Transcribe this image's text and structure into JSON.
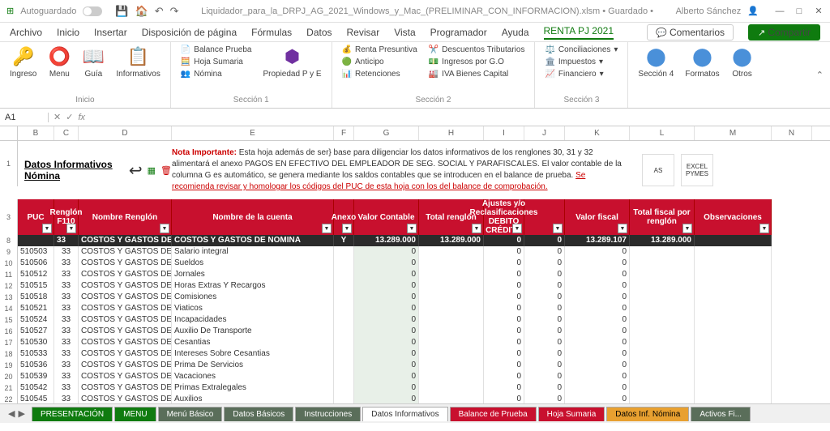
{
  "titlebar": {
    "autosave": "Autoguardado",
    "filename": "Liquidador_para_la_DRPJ_AG_2021_Windows_y_Mac_(PRELIMINAR_CON_INFORMACION).xlsm • Guardado •",
    "user": "Alberto Sánchez"
  },
  "menu": {
    "items": [
      "Archivo",
      "Inicio",
      "Insertar",
      "Disposición de página",
      "Fórmulas",
      "Datos",
      "Revisar",
      "Vista",
      "Programador",
      "Ayuda",
      "RENTA PJ 2021"
    ],
    "comments": "Comentarios",
    "share": "Compartir"
  },
  "ribbon": {
    "g1": {
      "label": "Inicio",
      "items": [
        "Ingreso",
        "Menu",
        "Guía",
        "Informativos"
      ]
    },
    "g2": {
      "label": "Sección 1",
      "big": "Propiedad P y E",
      "small": [
        "Balance Prueba",
        "Hoja Sumaria",
        "Nómina"
      ]
    },
    "g3": {
      "label": "Sección 2",
      "col1": [
        "Renta Presuntiva",
        "Anticipo",
        "Retenciones"
      ],
      "col2": [
        "Descuentos Tributarios",
        "Ingresos por G.O",
        "IVA Bienes Capital"
      ]
    },
    "g4": {
      "label": "Sección 3",
      "items": [
        "Conciliaciones",
        "Impuestos",
        "Financiero"
      ]
    },
    "g5": {
      "items": [
        "Sección 4",
        "Formatos",
        "Otros"
      ]
    }
  },
  "namebox": "A1",
  "cols": [
    "B",
    "C",
    "D",
    "E",
    "F",
    "G",
    "H",
    "I",
    "J",
    "K",
    "L",
    "M",
    "N"
  ],
  "content": {
    "title": "Datos Informativos Nómina",
    "note_bold": "Nota Importante:",
    "note_text": " Esta hoja además de ser} base para diligenciar los datos informativos de los renglones 30, 31 y 32 alimentará el anexo PAGOS EN EFECTIVO DEL EMPLEADOR DE SEG. SOCIAL Y PARAFISCALES. El valor contable de la columna G es automático, se genera mediante los saldos contables que se introducen en el balance de prueba. ",
    "note_red": "Se recomienda revisar y homologar los códigos del PUC de esta hoja con los del balance de comprobación."
  },
  "headers": [
    "PUC",
    "Renglón F110",
    "Nombre Renglón",
    "Nombre de la cuenta",
    "Anexo",
    "Valor Contable",
    "Total renglón",
    "Ajustes y/o Reclasificaciones DEBITO CRÉDITO",
    "",
    "Valor fiscal",
    "Total fiscal por renglón",
    "Observaciones"
  ],
  "totalrow": {
    "renglon": "33",
    "nombre": "COSTOS Y GASTOS DE NO",
    "cuenta": "COSTOS Y GASTOS DE NOMINA",
    "anexo": "Y",
    "valcont": "13.289.000",
    "totren": "13.289.000",
    "aj1": "0",
    "aj2": "0",
    "valfis": "13.289.107",
    "totfis": "13.289.000"
  },
  "rows": [
    {
      "n": "9",
      "puc": "510503",
      "r": "33",
      "nr": "COSTOS Y GASTOS DE NOI",
      "c": "Salario integral"
    },
    {
      "n": "10",
      "puc": "510506",
      "r": "33",
      "nr": "COSTOS Y GASTOS DE NOI",
      "c": "Sueldos"
    },
    {
      "n": "11",
      "puc": "510512",
      "r": "33",
      "nr": "COSTOS Y GASTOS DE NOI",
      "c": "Jornales"
    },
    {
      "n": "12",
      "puc": "510515",
      "r": "33",
      "nr": "COSTOS Y GASTOS DE NOI",
      "c": "Horas Extras Y Recargos"
    },
    {
      "n": "13",
      "puc": "510518",
      "r": "33",
      "nr": "COSTOS Y GASTOS DE NOI",
      "c": "Comisiones"
    },
    {
      "n": "14",
      "puc": "510521",
      "r": "33",
      "nr": "COSTOS Y GASTOS DE NOI",
      "c": "Viaticos"
    },
    {
      "n": "15",
      "puc": "510524",
      "r": "33",
      "nr": "COSTOS Y GASTOS DE NOI",
      "c": "Incapacidades"
    },
    {
      "n": "16",
      "puc": "510527",
      "r": "33",
      "nr": "COSTOS Y GASTOS DE NOI",
      "c": "Auxilio De Transporte"
    },
    {
      "n": "17",
      "puc": "510530",
      "r": "33",
      "nr": "COSTOS Y GASTOS DE NOI",
      "c": "Cesantias"
    },
    {
      "n": "18",
      "puc": "510533",
      "r": "33",
      "nr": "COSTOS Y GASTOS DE NOI",
      "c": "Intereses Sobre Cesantias"
    },
    {
      "n": "19",
      "puc": "510536",
      "r": "33",
      "nr": "COSTOS Y GASTOS DE NOI",
      "c": "Prima De Servicios"
    },
    {
      "n": "20",
      "puc": "510539",
      "r": "33",
      "nr": "COSTOS Y GASTOS DE NOI",
      "c": "Vacaciones"
    },
    {
      "n": "21",
      "puc": "510542",
      "r": "33",
      "nr": "COSTOS Y GASTOS DE NOI",
      "c": "Primas Extralegales"
    },
    {
      "n": "22",
      "puc": "510545",
      "r": "33",
      "nr": "COSTOS Y GASTOS DE NOI",
      "c": "Auxilios"
    }
  ],
  "tabs": [
    {
      "l": "PRESENTACIÓN",
      "bg": "#0f7b0f",
      "fg": "#fff"
    },
    {
      "l": "MENU",
      "bg": "#0f7b0f",
      "fg": "#fff"
    },
    {
      "l": "Menú Básico",
      "bg": "#5a6e5a",
      "fg": "#fff"
    },
    {
      "l": "Datos Básicos",
      "bg": "#5a6e5a",
      "fg": "#fff"
    },
    {
      "l": "Instrucciones",
      "bg": "#5a6e5a",
      "fg": "#fff"
    },
    {
      "l": "Datos Informativos",
      "bg": "#fff",
      "fg": "#333"
    },
    {
      "l": "Balance de Prueba",
      "bg": "#c8102e",
      "fg": "#fff"
    },
    {
      "l": "Hoja Sumaria",
      "bg": "#c8102e",
      "fg": "#fff"
    },
    {
      "l": "Datos Inf. Nómina",
      "bg": "#e8a030",
      "fg": "#000"
    },
    {
      "l": "Activos Fi...",
      "bg": "#5a6e5a",
      "fg": "#fff"
    }
  ],
  "colwidths": {
    "B": 45,
    "C": 30,
    "D": 115,
    "E": 200,
    "F": 25,
    "G": 80,
    "H": 80,
    "I": 50,
    "J": 50,
    "K": 80,
    "L": 80,
    "M": 95,
    "N": 50
  }
}
